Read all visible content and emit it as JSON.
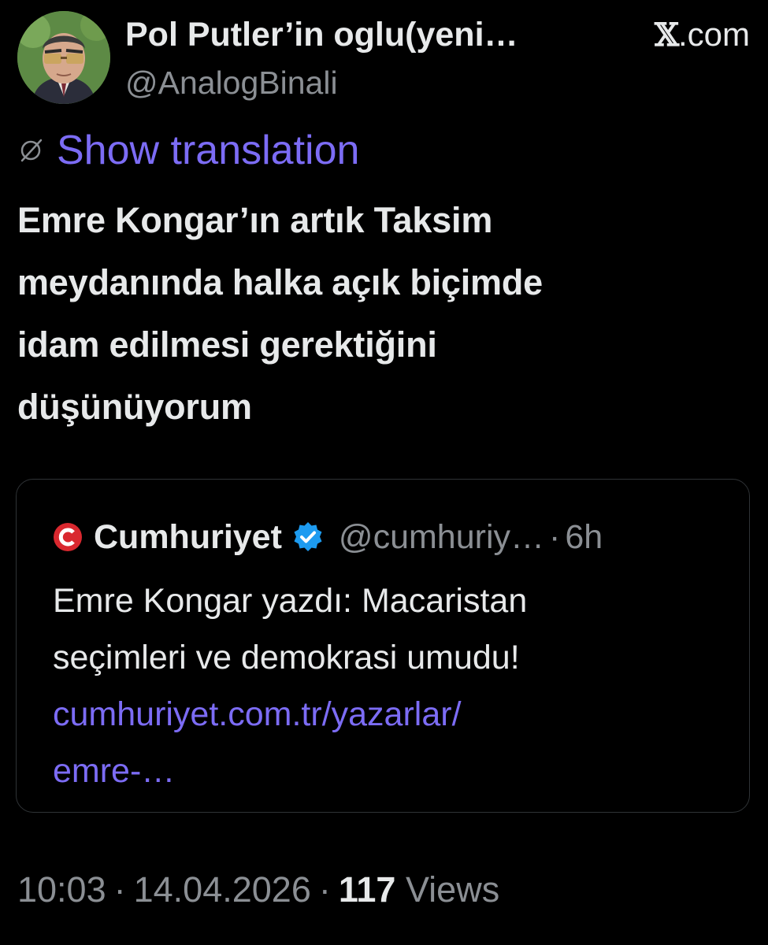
{
  "author": {
    "display_name": "Pol Putler’in oglu(yeni…",
    "handle": "@AnalogBinali"
  },
  "source_label": ".com",
  "source_glyph": "𝕏",
  "translation": {
    "label": "Show translation",
    "icon": "globe-slash-icon"
  },
  "tweet": {
    "lines": [
      "Emre Kongar’ın artık Taksim",
      "meydanında halka açık biçimde",
      "idam edilmesi gerektiğini",
      "düşünüyorum"
    ]
  },
  "quote": {
    "logo_icon": "cumhuriyet-c-logo-icon",
    "name": "Cumhuriyet",
    "verified_icon": "verified-badge-icon",
    "handle": "@cumhuriy…",
    "dot": "·",
    "time": "6h",
    "text_lines": [
      "Emre Kongar yazdı: Macaristan",
      "seçimleri ve demokrasi umudu!"
    ],
    "link_lines": [
      "cumhuriyet.com.tr/yazarlar/",
      "emre-…"
    ]
  },
  "meta": {
    "time": "10:03",
    "date": "14.04.2026",
    "sep": "·",
    "views_count": "117",
    "views_label": "Views"
  },
  "colors": {
    "background": "#000000",
    "text": "#e7e9ea",
    "muted": "#8b8f94",
    "accent": "#7c6cf5",
    "verified": "#1d9bf0",
    "cumhuriyet_red": "#d9282f",
    "border": "#2f3336"
  }
}
